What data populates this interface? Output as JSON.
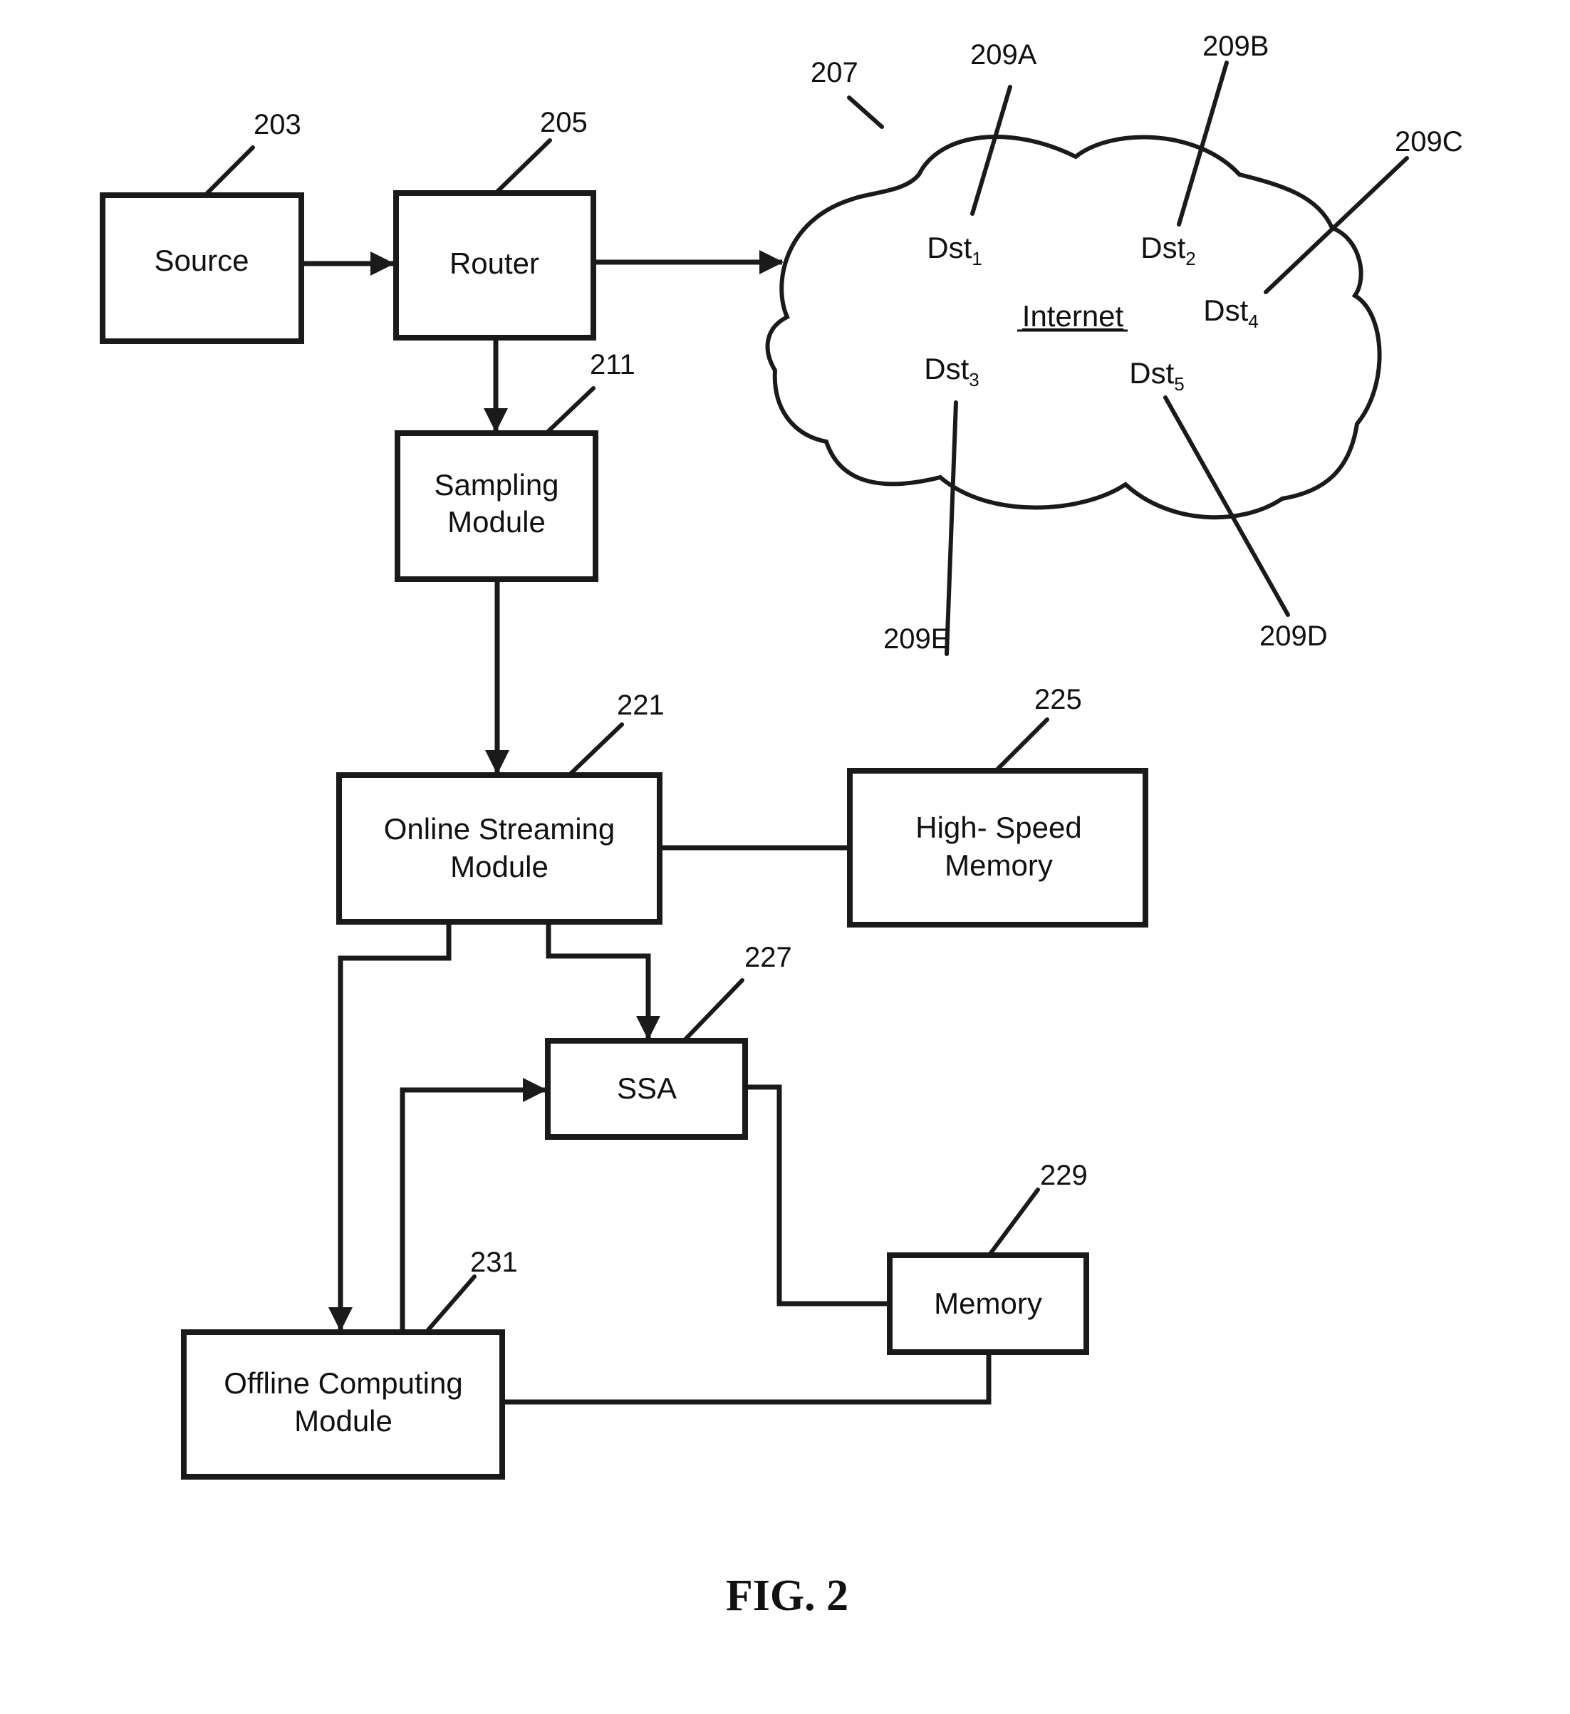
{
  "figure": {
    "caption": "FIG. 2",
    "nodes": {
      "source": {
        "ref": "203",
        "lines": [
          "Source"
        ]
      },
      "router": {
        "ref": "205",
        "lines": [
          "Router"
        ]
      },
      "sampling": {
        "ref": "211",
        "lines": [
          "Sampling",
          "Module"
        ]
      },
      "online": {
        "ref": "221",
        "lines": [
          "Online Streaming",
          "Module"
        ]
      },
      "highspeed": {
        "ref": "225",
        "lines": [
          "High- Speed",
          "Memory"
        ]
      },
      "ssa": {
        "ref": "227",
        "lines": [
          "SSA"
        ]
      },
      "memory": {
        "ref": "229",
        "lines": [
          "Memory"
        ]
      },
      "offline": {
        "ref": "231",
        "lines": [
          "Offline Computing",
          "Module"
        ]
      }
    },
    "cloud": {
      "ref": "207",
      "label": "Internet",
      "destinations": [
        {
          "base": "Dst",
          "sub": "1",
          "ref": "209A"
        },
        {
          "base": "Dst",
          "sub": "2",
          "ref": "209B"
        },
        {
          "base": "Dst",
          "sub": "4",
          "ref": "209C"
        },
        {
          "base": "Dst",
          "sub": "3",
          "ref": "209E"
        },
        {
          "base": "Dst",
          "sub": "5",
          "ref": "209D"
        }
      ]
    },
    "edges": [
      {
        "from": "source",
        "to": "router",
        "arrow": true
      },
      {
        "from": "router",
        "to": "cloud",
        "arrow": true
      },
      {
        "from": "router",
        "to": "sampling",
        "arrow": true
      },
      {
        "from": "sampling",
        "to": "online",
        "arrow": true
      },
      {
        "from": "online",
        "to": "highspeed",
        "arrow": false
      },
      {
        "from": "online",
        "to": "ssa",
        "arrow": true
      },
      {
        "from": "online",
        "to": "offline",
        "arrow": true
      },
      {
        "from": "offline",
        "to": "ssa",
        "arrow": true
      },
      {
        "from": "ssa",
        "to": "memory",
        "arrow": false
      },
      {
        "from": "memory",
        "to": "offline",
        "arrow": false
      }
    ]
  }
}
